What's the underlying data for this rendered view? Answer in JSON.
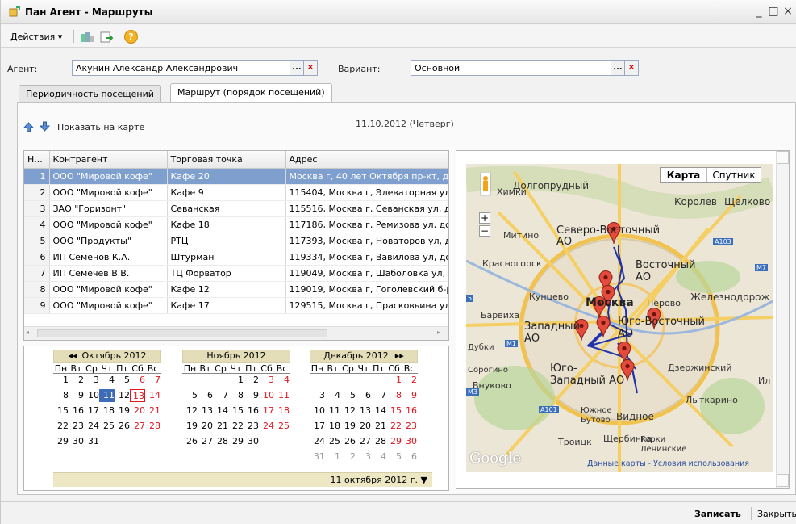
{
  "window": {
    "title": "Пан Агент - Маршруты",
    "min": "_",
    "max": "□",
    "close": "×"
  },
  "toolbar": {
    "actions": "Действия",
    "dropdown": "▾",
    "help": "?"
  },
  "form": {
    "agent_label": "Агент:",
    "agent_value": "Акунин Александр Александрович",
    "variant_label": "Вариант:",
    "variant_value": "Основной",
    "select_btn": "...",
    "clear_btn": "×"
  },
  "tabs": [
    {
      "label": "Периодичность посещений"
    },
    {
      "label": "Маршрут (порядок посещений)"
    }
  ],
  "route": {
    "show_map": "Показать на карте",
    "date": "11.10.2012 (Четверг)"
  },
  "table": {
    "headers": [
      "Н...",
      "Контрагент",
      "Торговая точка",
      "Адрес"
    ],
    "rows": [
      [
        "1",
        "ООО \"Мировой кофе\"",
        "Кафе 20",
        "Москва г, 40 лет Октября пр-кт, до"
      ],
      [
        "2",
        "ООО \"Мировой кофе\"",
        "Кафе 9",
        "115404, Москва г, Элеваторная ул,"
      ],
      [
        "3",
        "ЗАО \"Горизонт\"",
        "Севанская",
        "115516, Москва г, Севанская ул, до"
      ],
      [
        "4",
        "ООО \"Мировой кофе\"",
        "Кафе 18",
        "117186, Москва г, Ремизова ул, до"
      ],
      [
        "5",
        "ООО \"Продукты\"",
        "РТЦ",
        "117393, Москва г, Новаторов ул, до"
      ],
      [
        "6",
        "ИП Семенов К.А.",
        "Штурман",
        "119334, Москва г, Вавилова ул, дом"
      ],
      [
        "7",
        "ИП Семечев В.В.",
        "ТЦ Форватор",
        "119049, Москва г, Шаболовка ул, д"
      ],
      [
        "8",
        "ООО \"Мировой кофе\"",
        "Кафе 12",
        "119019, Москва г, Гоголевский б-р"
      ],
      [
        "9",
        "ООО \"Мировой кофе\"",
        "Кафе 17",
        "129515, Москва г, Прасковьина ул,"
      ]
    ]
  },
  "calendar": {
    "weekdays": [
      "Пн",
      "Вт",
      "Ср",
      "Чт",
      "Пт",
      "Сб",
      "Вс"
    ],
    "months": [
      {
        "title": "Октябрь 2012",
        "prev": "◂◂",
        "weeks": [
          [
            "1",
            "2",
            "3",
            "4",
            "5",
            "6",
            "7"
          ],
          [
            "8",
            "9",
            "10",
            "11",
            "12",
            "13",
            "14"
          ],
          [
            "15",
            "16",
            "17",
            "18",
            "19",
            "20",
            "21"
          ],
          [
            "22",
            "23",
            "24",
            "25",
            "26",
            "27",
            "28"
          ],
          [
            "29",
            "30",
            "31",
            "",
            "",
            "",
            ""
          ]
        ]
      },
      {
        "title": "Ноябрь 2012",
        "weeks": [
          [
            "",
            "",
            "",
            "1",
            "2",
            "3",
            "4"
          ],
          [
            "5",
            "6",
            "7",
            "8",
            "9",
            "10",
            "11"
          ],
          [
            "12",
            "13",
            "14",
            "15",
            "16",
            "17",
            "18"
          ],
          [
            "19",
            "20",
            "21",
            "22",
            "23",
            "24",
            "25"
          ],
          [
            "26",
            "27",
            "28",
            "29",
            "30",
            "",
            ""
          ]
        ]
      },
      {
        "title": "Декабрь 2012",
        "next": "▸▸",
        "weeks": [
          [
            "",
            "",
            "",
            "",
            "",
            "1",
            "2"
          ],
          [
            "3",
            "4",
            "5",
            "6",
            "7",
            "8",
            "9"
          ],
          [
            "10",
            "11",
            "12",
            "13",
            "14",
            "15",
            "16"
          ],
          [
            "17",
            "18",
            "19",
            "20",
            "21",
            "22",
            "23"
          ],
          [
            "24",
            "25",
            "26",
            "27",
            "28",
            "29",
            "30"
          ],
          [
            "31",
            "1",
            "2",
            "3",
            "4",
            "5",
            "6"
          ]
        ]
      }
    ],
    "selected": "11 октября 2012 г.",
    "dropdown": "▼"
  },
  "map": {
    "type_map": "Карта",
    "type_satellite": "Спутник",
    "zoom_in": "+",
    "zoom_out": "−",
    "labels": [
      "Долгопрудный",
      "Королев",
      "Щелково",
      "Митино",
      "Северо-Восточный АО",
      "Красногорск",
      "Восточный АО",
      "Кунцево",
      "Москва",
      "Перово",
      "Железнодорож",
      "Барвиха",
      "Западный АО",
      "Юго-Восточный АО",
      "Юго-Западный АО",
      "Дзержинский",
      "Внуково",
      "Лыткарино",
      "Видное",
      "Южное Бутово",
      "Горки Ленинские",
      "Троицк",
      "Щербинка",
      "Химки",
      "Дубки",
      "Сорогино",
      "Ил"
    ],
    "logo": "Google",
    "attribution": "Данные карты - Условия использования",
    "badge_a103": "A103",
    "badge_m7": "M7",
    "badge_m3": "M3",
    "badge_a101": "A101",
    "badge_m1": "M1",
    "badge_5": "5"
  },
  "bottom": {
    "save": "Записать",
    "close": "Закрыть"
  },
  "colors": {
    "selection": "#7fa0cf",
    "today": "#3d6bb7",
    "weekend": "#e2141c",
    "pin": "#e54b3c",
    "route": "#2233aa"
  }
}
